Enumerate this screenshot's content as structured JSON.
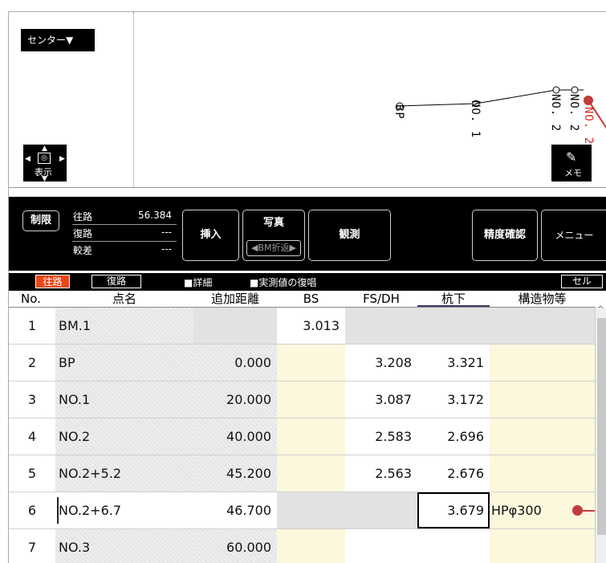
{
  "map": {
    "center_label": "センター▼",
    "display_label": "表示",
    "memo_label": "メモ",
    "route_labels": [
      "BP",
      "NO. 1",
      "NO. 2",
      "NO. 2",
      "NO. 2"
    ]
  },
  "toolbar": {
    "seigen": "制限",
    "rows": [
      {
        "label": "往路",
        "value": "56.384"
      },
      {
        "label": "復路",
        "value": "---"
      },
      {
        "label": "較差",
        "value": "---"
      }
    ],
    "insert": "挿入",
    "photo": "写真",
    "bm_fold": "◀BM折返▶",
    "observe": "観測",
    "precision": "精度確認",
    "menu": "メニュー"
  },
  "options": {
    "ouro": "往路",
    "fukuro": "復路",
    "detail": "■詳細",
    "recall": "■実測値の復唱",
    "cell": "セル"
  },
  "table": {
    "headers": [
      "No.",
      "点名",
      "追加距離",
      "BS",
      "FS/DH",
      "杭下",
      "構造物等"
    ],
    "rows": [
      {
        "no": "1",
        "name": "BM.1",
        "dist": "",
        "bs": "3.013",
        "fs": "",
        "kui": "",
        "struct": ""
      },
      {
        "no": "2",
        "name": "BP",
        "dist": "0.000",
        "bs": "",
        "fs": "3.208",
        "kui": "3.321",
        "struct": ""
      },
      {
        "no": "3",
        "name": "NO.1",
        "dist": "20.000",
        "bs": "",
        "fs": "3.087",
        "kui": "3.172",
        "struct": ""
      },
      {
        "no": "4",
        "name": "NO.2",
        "dist": "40.000",
        "bs": "",
        "fs": "2.583",
        "kui": "2.696",
        "struct": ""
      },
      {
        "no": "5",
        "name": "NO.2+5.2",
        "dist": "45.200",
        "bs": "",
        "fs": "2.563",
        "kui": "2.676",
        "struct": ""
      },
      {
        "no": "6",
        "name": "NO.2+6.7",
        "dist": "46.700",
        "bs": "",
        "fs": "",
        "kui": "3.679",
        "struct": "HPφ300"
      },
      {
        "no": "7",
        "name": "NO.3",
        "dist": "60.000",
        "bs": "",
        "fs": "",
        "kui": "",
        "struct": ""
      }
    ]
  },
  "colors": {
    "accent": "#e8471a",
    "callout": "#c23b3b"
  }
}
